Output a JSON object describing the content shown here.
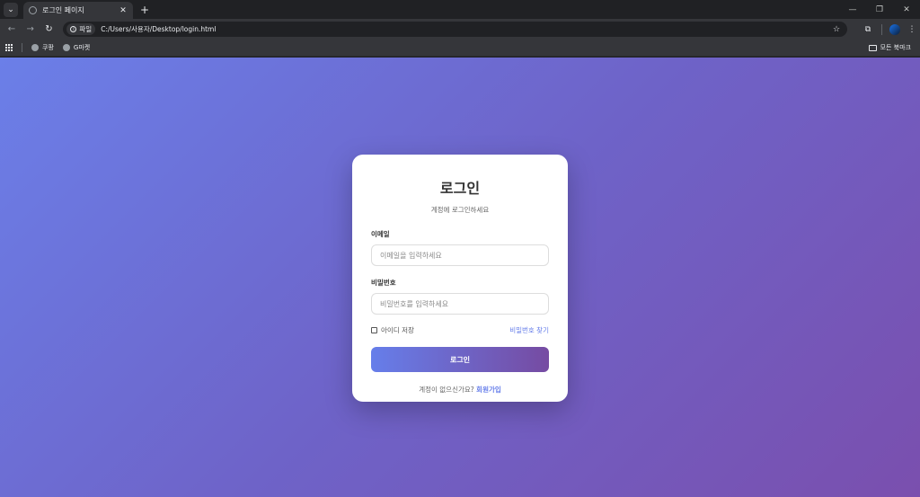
{
  "browser": {
    "tab_title": "로그인 페이지",
    "tab_close": "✕",
    "new_tab": "+",
    "tab_search": "⌄",
    "site_chip": "파일",
    "url": "C:/Users/사용자/Desktop/login.html",
    "icons": [
      "back-icon",
      "forward-icon",
      "reload-icon",
      "star-icon",
      "extensions-icon",
      "menu-icon"
    ]
  },
  "bookmarks": {
    "items": [
      {
        "label": "쿠팡"
      },
      {
        "label": "G마켓"
      }
    ],
    "all_bookmarks": "모든 북마크"
  },
  "login": {
    "title": "로그인",
    "subtitle": "계정에 로그인하세요",
    "email_label": "이메일",
    "email_placeholder": "이메일을 입력하세요",
    "password_label": "비밀번호",
    "password_placeholder": "비밀번호를 입력하세요",
    "remember_label": "아이디 저장",
    "forgot_link": "비밀번호 찾기",
    "submit_label": "로그인",
    "signup_prompt": "계정이 없으신가요?",
    "signup_link": "회원가입"
  },
  "colors": {
    "gradient_start": "#667eea",
    "gradient_end": "#764ba2",
    "card_bg": "#ffffff",
    "chrome_dark": "#202124",
    "chrome_toolbar": "#35363a"
  }
}
